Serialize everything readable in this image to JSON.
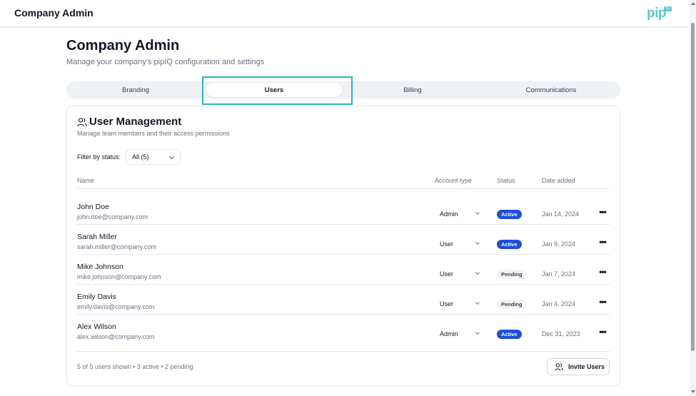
{
  "header": {
    "title": "Company Admin",
    "logo_text": "pip",
    "logo_badge": "IQ"
  },
  "page": {
    "title": "Company Admin",
    "subtitle": "Manage your company's pipIQ configuration and settings"
  },
  "tabs": [
    {
      "label": "Branding",
      "active": false
    },
    {
      "label": "Users",
      "active": true
    },
    {
      "label": "Billing",
      "active": false
    },
    {
      "label": "Communications",
      "active": false
    }
  ],
  "user_management": {
    "title": "User Management",
    "description": "Manage team members and their access permissions",
    "filter_label": "Filter by status:",
    "filter_value": "All (5)",
    "columns": {
      "name": "Name",
      "account_type": "Account type",
      "status": "Status",
      "date_added": "Date added"
    },
    "users": [
      {
        "name": "John Doe",
        "email": "john.doe@company.com",
        "account_type": "Admin",
        "status": "Active",
        "date": "Jan 14, 2024"
      },
      {
        "name": "Sarah Miller",
        "email": "sarah.miller@company.com",
        "account_type": "User",
        "status": "Active",
        "date": "Jan 9, 2024"
      },
      {
        "name": "Mike Johnson",
        "email": "mike.johnson@company.com",
        "account_type": "User",
        "status": "Pending",
        "date": "Jan 7, 2024"
      },
      {
        "name": "Emily Davis",
        "email": "emily.davis@company.com",
        "account_type": "User",
        "status": "Pending",
        "date": "Jan 4, 2024"
      },
      {
        "name": "Alex Wilson",
        "email": "alex.wilson@company.com",
        "account_type": "Admin",
        "status": "Active",
        "date": "Dec 31, 2023"
      }
    ],
    "more_glyph": "•••",
    "summary": "5 of 5 users shown • 3 active • 2 pending",
    "invite_label": "Invite Users"
  },
  "colors": {
    "accent": "#2cb5b9",
    "active_badge": "#1d4ed8",
    "logo": "#5ec9c9"
  }
}
